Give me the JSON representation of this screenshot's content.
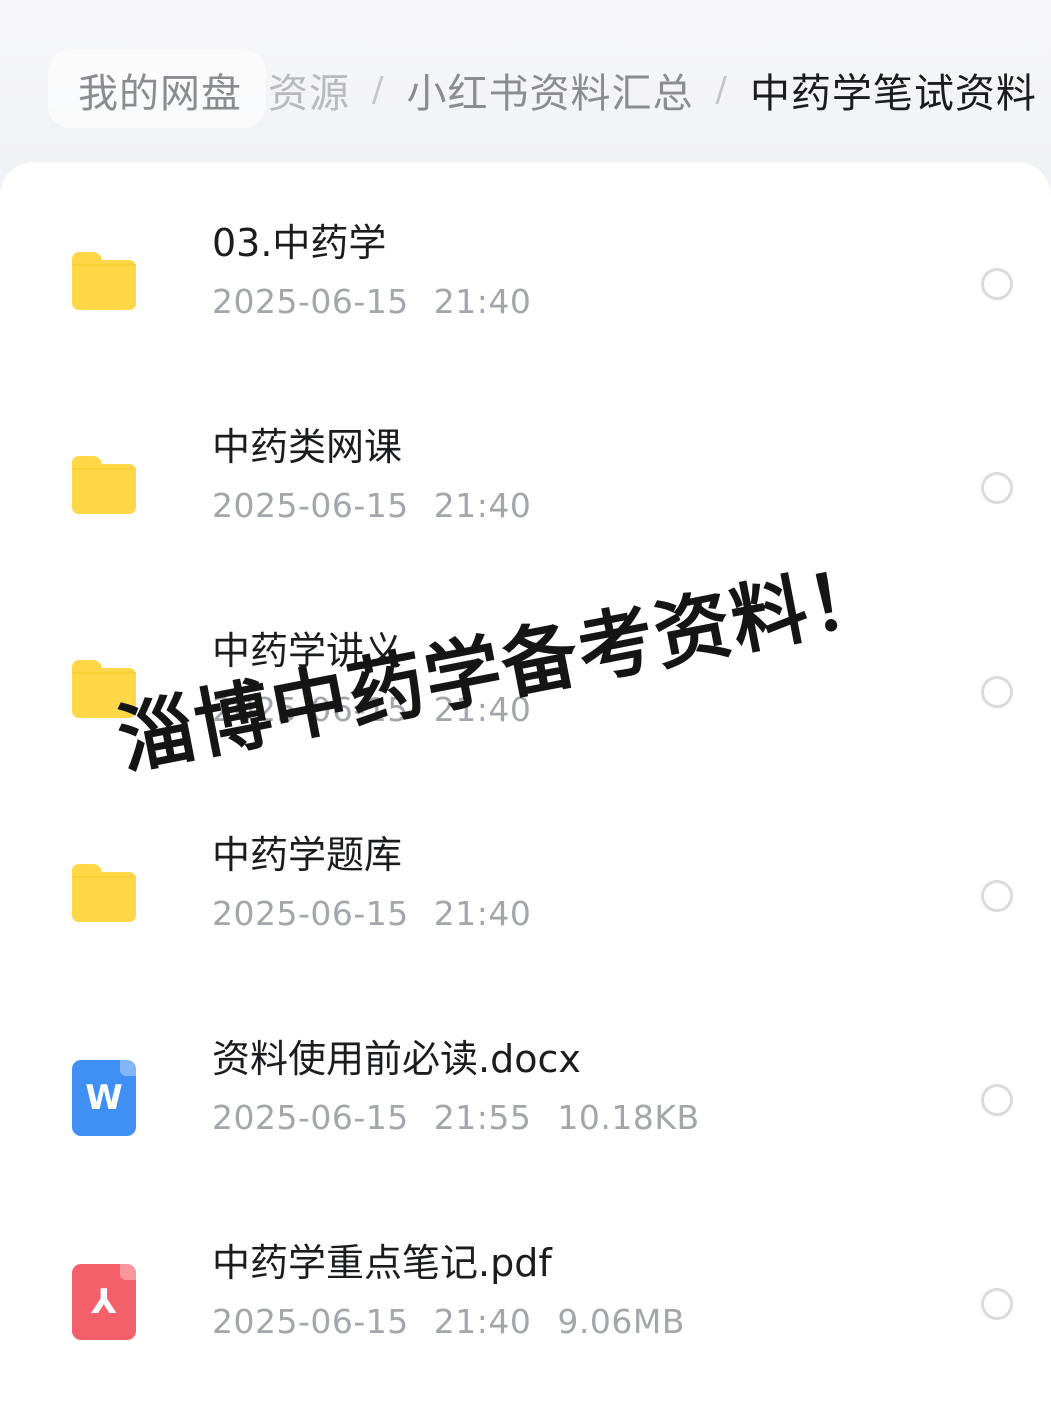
{
  "breadcrumb": {
    "items": [
      {
        "label": "我的网盘"
      },
      {
        "label": "资源"
      },
      {
        "label": "小红书资料汇总"
      },
      {
        "label": "中药学笔试资料"
      }
    ]
  },
  "files": [
    {
      "name": "03.中药学",
      "type": "folder",
      "icon": "folder-icon",
      "date": "2025-06-15",
      "time": "21:40",
      "size": ""
    },
    {
      "name": "中药类网课",
      "type": "folder",
      "icon": "folder-icon",
      "date": "2025-06-15",
      "time": "21:40",
      "size": ""
    },
    {
      "name": "中药学讲义",
      "type": "folder",
      "icon": "folder-icon",
      "date": "2025-06-15",
      "time": "21:40",
      "size": ""
    },
    {
      "name": "中药学题库",
      "type": "folder",
      "icon": "folder-icon",
      "date": "2025-06-15",
      "time": "21:40",
      "size": ""
    },
    {
      "name": "资料使用前必读.docx",
      "type": "docx",
      "icon": "word-doc-icon",
      "icon_glyph": "W",
      "date": "2025-06-15",
      "time": "21:55",
      "size": "10.18KB"
    },
    {
      "name": "中药学重点笔记.pdf",
      "type": "pdf",
      "icon": "pdf-doc-icon",
      "icon_glyph": "⅄",
      "date": "2025-06-15",
      "time": "21:40",
      "size": "9.06MB"
    }
  ],
  "overlay_text": "淄博中药学备考资料！",
  "colors": {
    "folder": "#ffd747",
    "word": "#3f8ff5",
    "pdf": "#f4606a",
    "primary_text": "#1b1c1f",
    "secondary_text": "#a3a6ab"
  }
}
